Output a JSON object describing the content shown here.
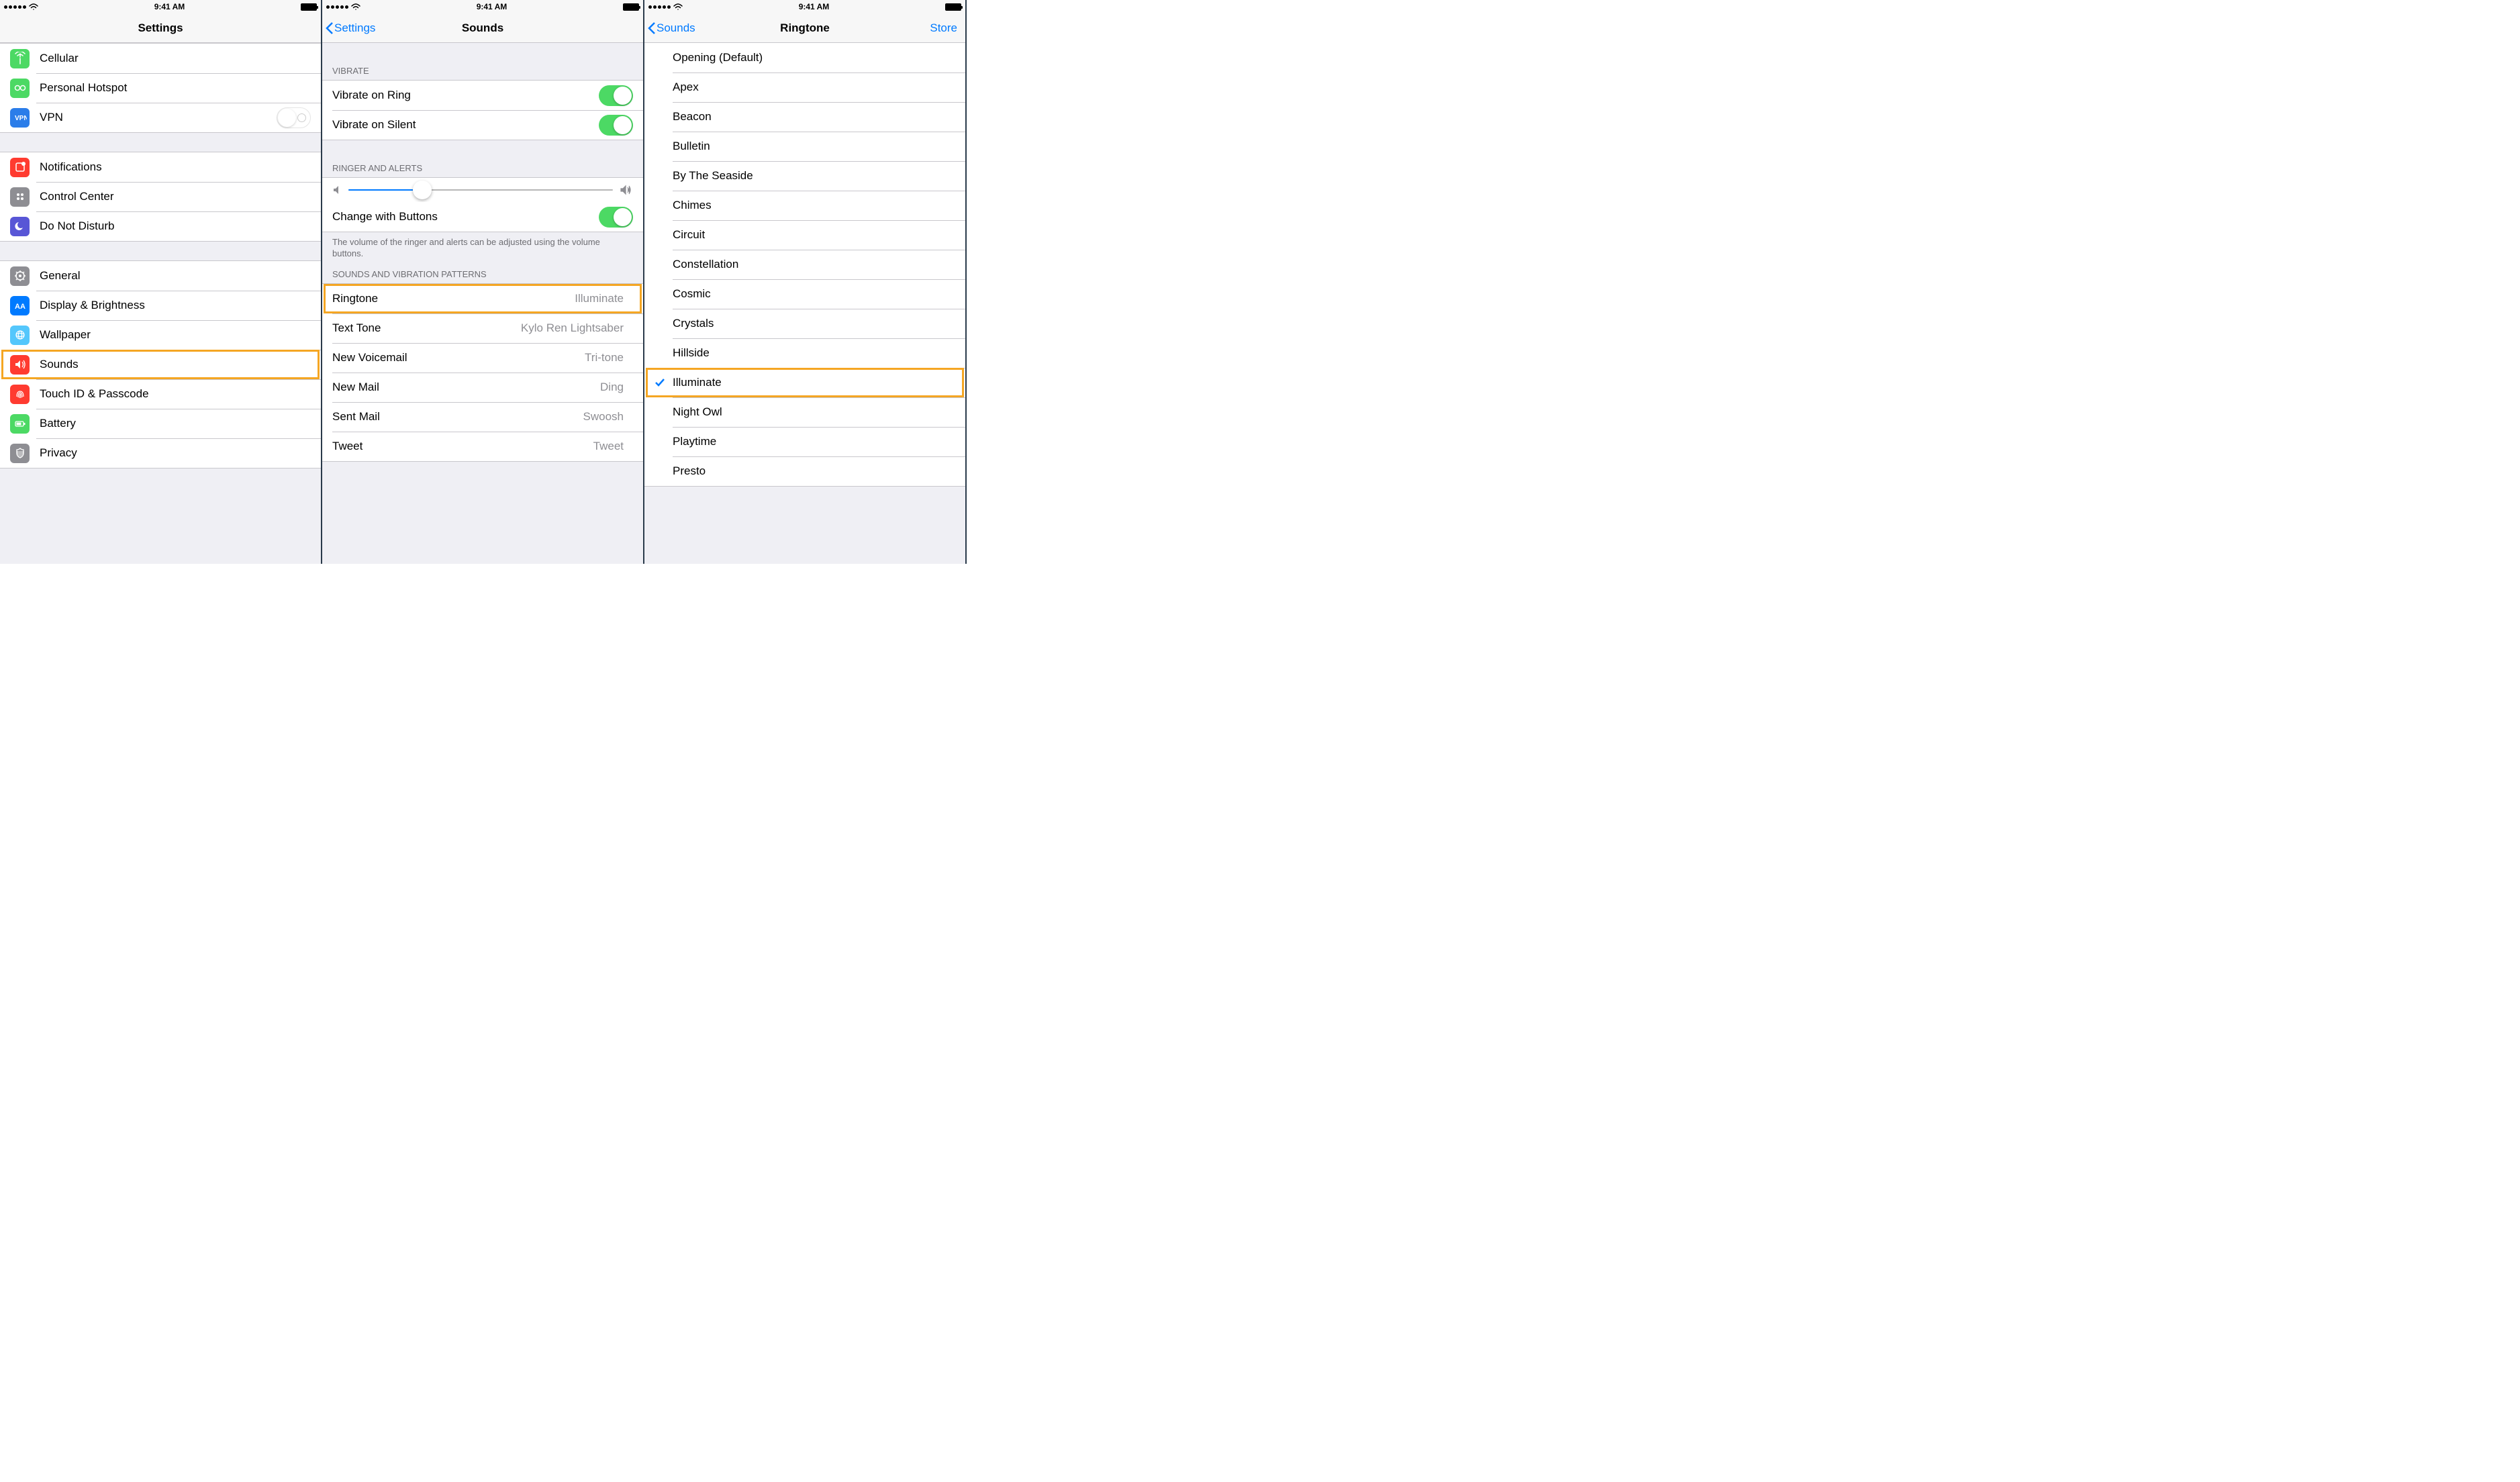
{
  "status": {
    "time": "9:41 AM"
  },
  "screen1": {
    "title": "Settings",
    "groups": [
      {
        "items": [
          {
            "icon": "cellular",
            "bg": "#4cd964",
            "label": "Cellular",
            "chevron": true
          },
          {
            "icon": "hotspot",
            "bg": "#4cd964",
            "label": "Personal Hotspot",
            "chevron": true
          },
          {
            "icon": "vpn",
            "bg": "#2b7de9",
            "label": "VPN",
            "toggle": "off"
          }
        ]
      },
      {
        "items": [
          {
            "icon": "notifications",
            "bg": "#ff3b30",
            "label": "Notifications",
            "chevron": true
          },
          {
            "icon": "control-center",
            "bg": "#8e8e93",
            "label": "Control Center",
            "chevron": true
          },
          {
            "icon": "dnd",
            "bg": "#5856d6",
            "label": "Do Not Disturb",
            "chevron": true
          }
        ]
      },
      {
        "items": [
          {
            "icon": "general",
            "bg": "#8e8e93",
            "label": "General",
            "chevron": true
          },
          {
            "icon": "display",
            "bg": "#007aff",
            "label": "Display & Brightness",
            "chevron": true
          },
          {
            "icon": "wallpaper",
            "bg": "#54c7fc",
            "label": "Wallpaper",
            "chevron": true
          },
          {
            "icon": "sounds",
            "bg": "#ff3b30",
            "label": "Sounds",
            "chevron": true,
            "highlight": true
          },
          {
            "icon": "touchid",
            "bg": "#ff3b30",
            "label": "Touch ID & Passcode",
            "chevron": true
          },
          {
            "icon": "battery",
            "bg": "#4cd964",
            "label": "Battery",
            "chevron": true
          },
          {
            "icon": "privacy",
            "bg": "#8e8e93",
            "label": "Privacy",
            "chevron": true
          }
        ]
      }
    ]
  },
  "screen2": {
    "back": "Settings",
    "title": "Sounds",
    "sec_vibrate": "VIBRATE",
    "vibrate_ring": "Vibrate on Ring",
    "vibrate_silent": "Vibrate on Silent",
    "sec_ringer": "RINGER AND ALERTS",
    "change_buttons": "Change with Buttons",
    "footer": "The volume of the ringer and alerts can be adjusted using the volume buttons.",
    "sec_sounds": "SOUNDS AND VIBRATION PATTERNS",
    "rows": [
      {
        "label": "Ringtone",
        "value": "Illuminate",
        "highlight": true
      },
      {
        "label": "Text Tone",
        "value": "Kylo Ren Lightsaber"
      },
      {
        "label": "New Voicemail",
        "value": "Tri-tone"
      },
      {
        "label": "New Mail",
        "value": "Ding"
      },
      {
        "label": "Sent Mail",
        "value": "Swoosh"
      },
      {
        "label": "Tweet",
        "value": "Tweet"
      }
    ]
  },
  "screen3": {
    "back": "Sounds",
    "title": "Ringtone",
    "action": "Store",
    "tones": [
      {
        "label": "Opening (Default)"
      },
      {
        "label": "Apex"
      },
      {
        "label": "Beacon"
      },
      {
        "label": "Bulletin"
      },
      {
        "label": "By The Seaside"
      },
      {
        "label": "Chimes"
      },
      {
        "label": "Circuit"
      },
      {
        "label": "Constellation"
      },
      {
        "label": "Cosmic"
      },
      {
        "label": "Crystals"
      },
      {
        "label": "Hillside"
      },
      {
        "label": "Illuminate",
        "checked": true,
        "highlight": true
      },
      {
        "label": "Night Owl"
      },
      {
        "label": "Playtime"
      },
      {
        "label": "Presto"
      }
    ]
  }
}
